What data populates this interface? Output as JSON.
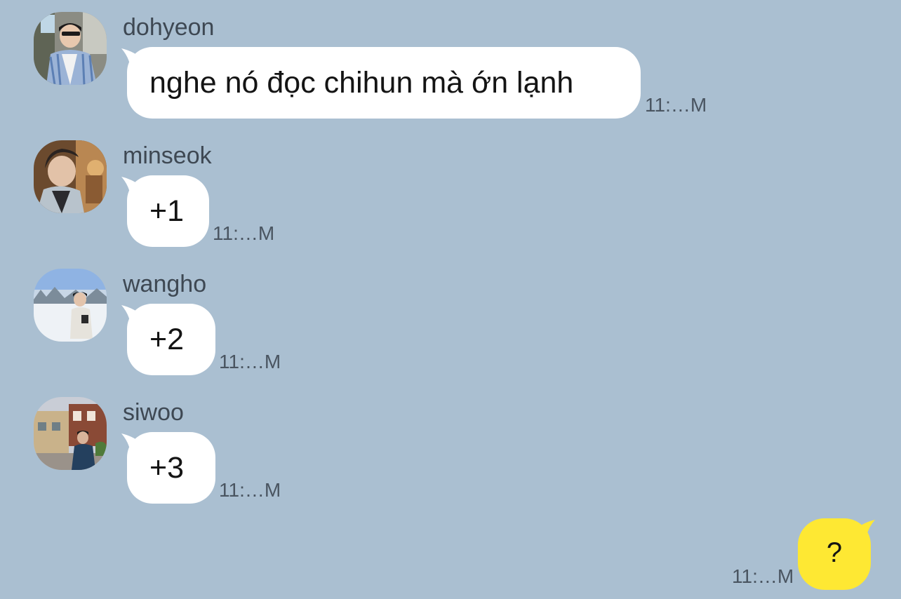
{
  "messages": [
    {
      "sender": "dohyeon",
      "text": "nghe nó đọc chihun mà ớn lạnh",
      "time": "11:…M",
      "avatar_icon": "profile-photo"
    },
    {
      "sender": "minseok",
      "text": "+1",
      "time": "11:…M",
      "avatar_icon": "profile-photo"
    },
    {
      "sender": "wangho",
      "text": "+2",
      "time": "11:…M",
      "avatar_icon": "profile-photo"
    },
    {
      "sender": "siwoo",
      "text": "+3",
      "time": "11:…M",
      "avatar_icon": "profile-photo"
    }
  ],
  "my_message": {
    "text": "?",
    "time": "11:…M"
  },
  "colors": {
    "background": "#aabfd1",
    "incoming_bubble": "#ffffff",
    "outgoing_bubble": "#fee833"
  }
}
